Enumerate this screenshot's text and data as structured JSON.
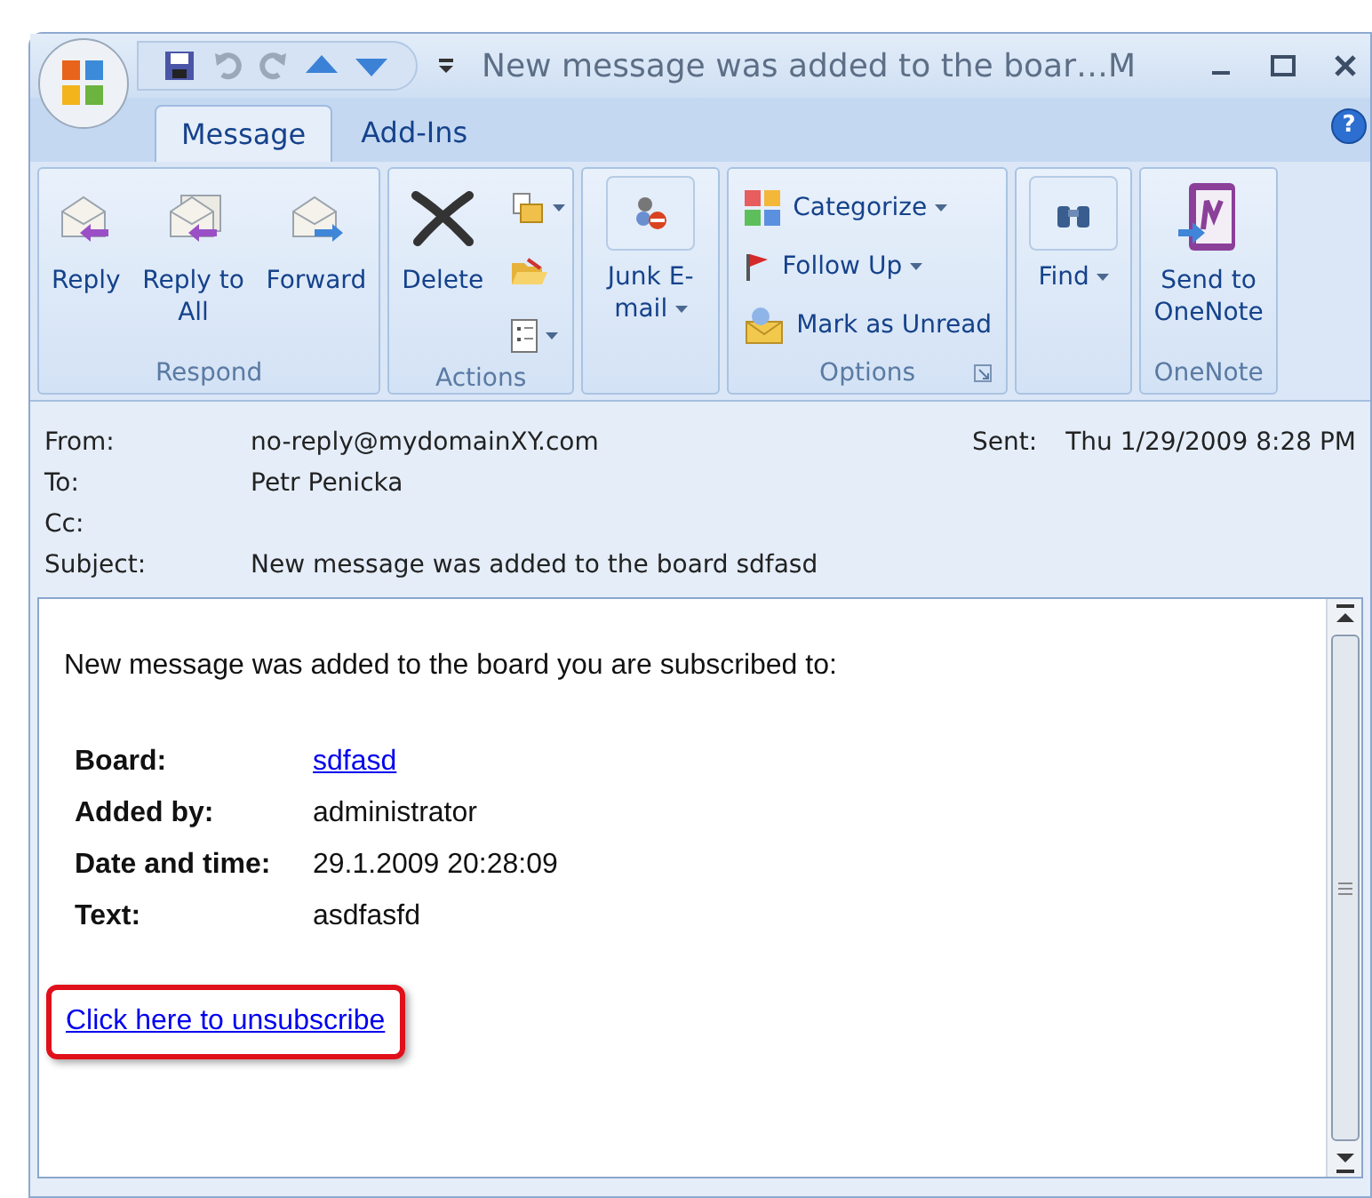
{
  "window": {
    "title": "New message was added to the boar…M"
  },
  "help": "?",
  "tabs": [
    {
      "label": "Message",
      "selected": true
    },
    {
      "label": "Add-Ins",
      "selected": false
    }
  ],
  "ribbon": {
    "groups": [
      {
        "label": "Respond",
        "buttons": [
          {
            "kind": "large",
            "label": "Reply",
            "dropdown": false
          },
          {
            "kind": "large",
            "label": "Reply to All",
            "dropdown": false
          },
          {
            "kind": "large",
            "label": "Forward",
            "dropdown": false
          }
        ]
      },
      {
        "label": "Actions",
        "buttons": [
          {
            "kind": "large",
            "label": "Delete",
            "dropdown": false
          },
          {
            "kind": "stack",
            "dropdown": true
          },
          {
            "kind": "stack",
            "dropdown": false
          },
          {
            "kind": "stack",
            "dropdown": true
          }
        ]
      },
      {
        "buttons": [
          {
            "kind": "large",
            "label": "Junk E-mail",
            "dropdown": true
          }
        ]
      },
      {
        "label": "Options",
        "launcher": true,
        "buttons": [
          {
            "kind": "small",
            "label": "Categorize",
            "dropdown": true
          },
          {
            "kind": "small",
            "label": "Follow Up",
            "dropdown": true
          },
          {
            "kind": "small",
            "label": "Mark as Unread",
            "dropdown": false
          }
        ]
      },
      {
        "buttons": [
          {
            "kind": "large",
            "label": "Find",
            "dropdown": true
          }
        ]
      },
      {
        "label": "OneNote",
        "buttons": [
          {
            "kind": "large",
            "label": "Send to OneNote",
            "dropdown": false
          }
        ]
      }
    ]
  },
  "header": {
    "fields": [
      {
        "label": "From:",
        "value": "no-reply@mydomainXY.com"
      },
      {
        "label": "To:",
        "value": "Petr Penicka"
      },
      {
        "label": "Cc:"
      },
      {
        "label": "Subject:",
        "value": "New message was added to the board sdfasd"
      }
    ],
    "sent": {
      "label": "Sent:",
      "value": "Thu 1/29/2009 8:28 PM"
    }
  },
  "body": {
    "intro": "New message was added to the board you are subscribed to:",
    "details": [
      {
        "label": "Board:",
        "value": "sdfasd",
        "kind": "link"
      },
      {
        "label": "Added by:",
        "value": "administrator",
        "kind": "text"
      },
      {
        "label": "Date and time:",
        "value": "29.1.2009 20:28:09",
        "kind": "text"
      },
      {
        "label": "Text:",
        "value": "asdfasfd",
        "kind": "text"
      }
    ],
    "unsubscribe": {
      "label": "Click here to unsubscribe",
      "highlighted": true
    }
  }
}
